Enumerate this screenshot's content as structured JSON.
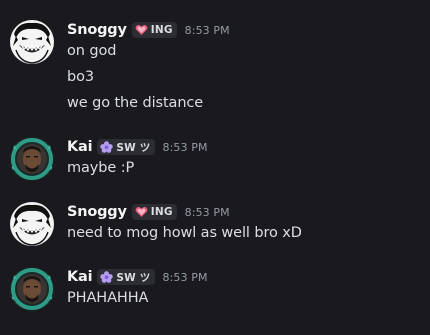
{
  "messages": [
    {
      "username": "Snoggy",
      "tag": "ING",
      "tag_icon": "heart-icon",
      "timestamp": "8:53 PM",
      "lines": [
        "on god",
        "bo3",
        "we go the distance"
      ]
    },
    {
      "username": "Kai",
      "tag": "SW ツ",
      "tag_icon": "flower-icon",
      "timestamp": "8:53 PM",
      "lines": [
        "maybe :P"
      ]
    },
    {
      "username": "Snoggy",
      "tag": "ING",
      "tag_icon": "heart-icon",
      "timestamp": "8:53 PM",
      "lines": [
        "need to mog howl as well bro xD"
      ]
    },
    {
      "username": "Kai",
      "tag": "SW ツ",
      "tag_icon": "flower-icon",
      "timestamp": "8:53 PM",
      "lines": [
        "PHAHAHHA"
      ]
    }
  ],
  "colors": {
    "background": "#1a1a1e",
    "username": "#f2f3f5",
    "text": "#dbdee1",
    "timestamp": "#949ba4",
    "heart_tag": "#e4607e",
    "flower_tag": "#b69cf2"
  }
}
